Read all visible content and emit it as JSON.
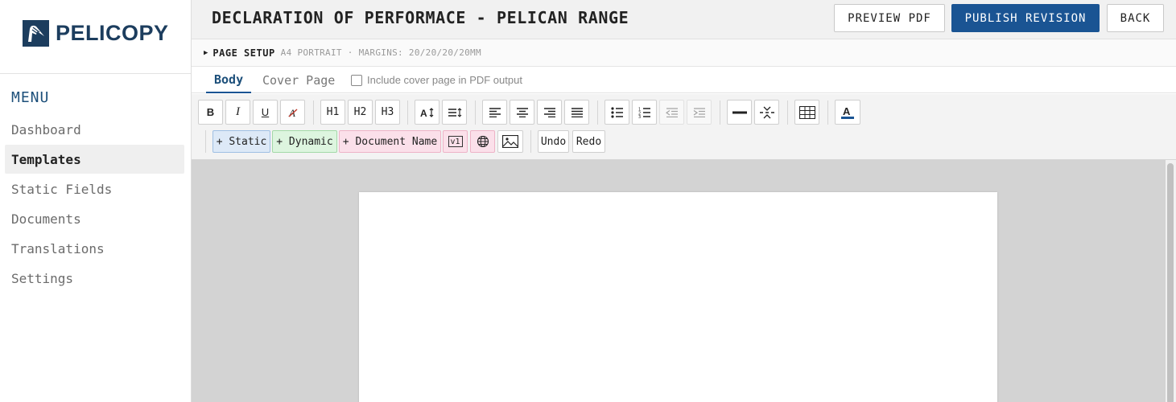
{
  "brand": {
    "name": "PELICOPY",
    "color": "#1c3d5e",
    "icon": "pelican-logo-icon"
  },
  "sidebar": {
    "heading": "MENU",
    "items": [
      {
        "label": "Dashboard",
        "active": false
      },
      {
        "label": "Templates",
        "active": true
      },
      {
        "label": "Static Fields",
        "active": false
      },
      {
        "label": "Documents",
        "active": false
      },
      {
        "label": "Translations",
        "active": false
      },
      {
        "label": "Settings",
        "active": false
      }
    ]
  },
  "header": {
    "title": "DECLARATION OF PERFORMACE - PELICAN RANGE",
    "preview_label": "PREVIEW PDF",
    "publish_label": "PUBLISH REVISION",
    "back_label": "BACK",
    "accent_color": "#1a5493"
  },
  "page_setup": {
    "label": "PAGE SETUP",
    "info": "A4 PORTRAIT · MARGINS: 20/20/20/20MM",
    "collapsed_icon": "triangle-right-icon"
  },
  "tabs": [
    {
      "label": "Body",
      "active": true
    },
    {
      "label": "Cover Page",
      "active": false
    }
  ],
  "cover_option": {
    "label": "Include cover page in PDF output",
    "checked": false
  },
  "toolbar": {
    "bold": "B",
    "italic": "I",
    "underline": "U",
    "h1": "H1",
    "h2": "H2",
    "h3": "H3",
    "static_chip": "+ Static",
    "dynamic_chip": "+ Dynamic",
    "document_name_chip": "+ Document Name",
    "version_chip": "v1",
    "undo": "Undo",
    "redo": "Redo",
    "text_color": "#1a5493",
    "icons": [
      "clear-format-icon",
      "font-size-icon",
      "line-height-icon",
      "align-left-icon",
      "align-center-icon",
      "align-right-icon",
      "align-justify-icon",
      "bullet-list-icon",
      "numbered-list-icon",
      "outdent-icon",
      "indent-icon",
      "horizontal-rule-icon",
      "page-break-icon",
      "table-icon",
      "text-color-icon",
      "globe-icon",
      "image-icon"
    ]
  }
}
